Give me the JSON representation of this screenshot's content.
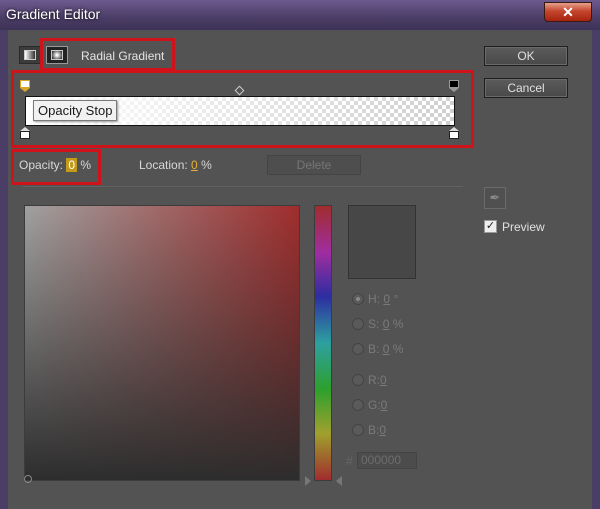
{
  "window": {
    "title": "Gradient Editor",
    "close_glyph": "✕"
  },
  "gradient_type": {
    "current": "Radial Gradient"
  },
  "tooltip": "Opacity Stop",
  "opacity": {
    "label": "Opacity:",
    "value": "0",
    "unit": "%"
  },
  "location": {
    "label": "Location:",
    "value": "0",
    "unit": "%"
  },
  "buttons": {
    "ok": "OK",
    "cancel": "Cancel",
    "delete": "Delete"
  },
  "color_model": {
    "h": {
      "prefix": "H:",
      "value": "0",
      "unit": "°"
    },
    "s": {
      "prefix": "S:",
      "value": "0",
      "unit": "%"
    },
    "b": {
      "prefix": "B:",
      "value": "0",
      "unit": "%"
    },
    "r": {
      "prefix": "R:",
      "value": "0"
    },
    "g": {
      "prefix": "G:",
      "value": "0"
    },
    "b2": {
      "prefix": "B:",
      "value": "0"
    }
  },
  "hex": {
    "prefix": "#",
    "value": "000000"
  },
  "preview": {
    "label": "Preview",
    "checked": true
  },
  "icons": [
    "linear-gradient-icon",
    "radial-gradient-icon",
    "eyedropper-icon",
    "checkbox-icon"
  ],
  "colors": {
    "highlight_box": "#d0121b",
    "value_accent": "#e8b233"
  }
}
